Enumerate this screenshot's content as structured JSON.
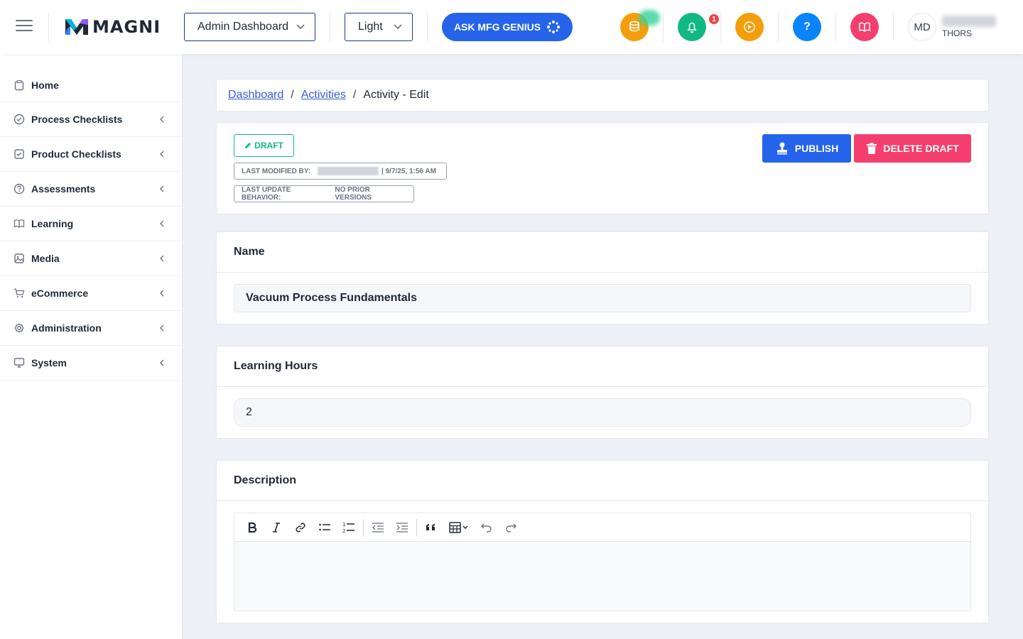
{
  "header": {
    "logo_text": "MAGNI",
    "dashboard_select": "Admin Dashboard",
    "theme_select": "Light",
    "ask_button": "ASK MFG GENIUS",
    "notification_count": "1",
    "user_initials": "MD",
    "user_org": "THORS"
  },
  "sidebar": {
    "items": [
      {
        "label": "Home"
      },
      {
        "label": "Process Checklists"
      },
      {
        "label": "Product Checklists"
      },
      {
        "label": "Assessments"
      },
      {
        "label": "Learning"
      },
      {
        "label": "Media"
      },
      {
        "label": "eCommerce"
      },
      {
        "label": "Administration"
      },
      {
        "label": "System"
      }
    ]
  },
  "breadcrumb": {
    "dashboard": "Dashboard",
    "sep1": "/",
    "activities": "Activities",
    "sep2": "/",
    "current": "Activity - Edit"
  },
  "status": {
    "draft_label": "DRAFT",
    "last_modified_label": "LAST MODIFIED BY:",
    "last_modified_date": "| 9/7/25, 1:56 AM",
    "last_update_label": "LAST UPDATE BEHAVIOR:",
    "last_update_value": "NO PRIOR VERSIONS",
    "publish_label": "PUBLISH",
    "delete_label": "DELETE DRAFT"
  },
  "form": {
    "name_label": "Name",
    "name_value": "Vacuum Process Fundamentals",
    "hours_label": "Learning Hours",
    "hours_value": "2",
    "description_label": "Description"
  },
  "colors": {
    "primary": "#2563eb",
    "danger": "#f43f6e",
    "success": "#10b981",
    "coins": "#f59e0b",
    "bell": "#10b981",
    "play": "#f59e0b",
    "help": "#0a84ff",
    "book": "#f43f6e"
  }
}
